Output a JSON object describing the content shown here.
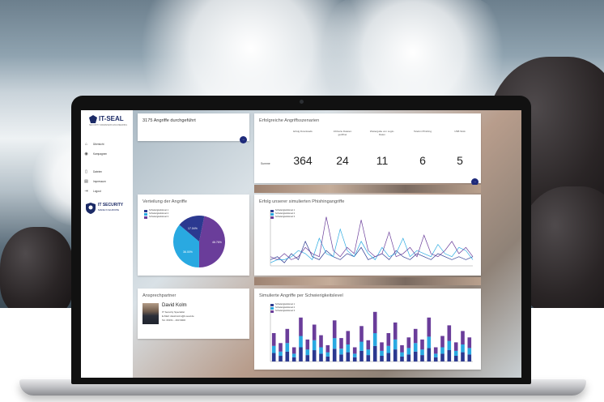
{
  "sidebar": {
    "logo": "IT-SEAL",
    "logo_sub": "SECURITY AWARENESS ENGINEERING",
    "items": [
      {
        "label": "Übersicht",
        "icon": "home-icon"
      },
      {
        "label": "Kampagnen",
        "icon": "target-icon"
      },
      {
        "label": "Dateien",
        "icon": "file-icon"
      },
      {
        "label": "Impressum",
        "icon": "document-icon"
      },
      {
        "label": "Logout",
        "icon": "logout-icon"
      }
    ],
    "badge_title": "IT SECURITY",
    "badge_sub": "MADE IN EUROPE"
  },
  "kpi": {
    "title": "3175 Angriffe durchgeführt"
  },
  "success": {
    "title": "Erfolgreiche Angriffsszenarien",
    "row_label": "Summe",
    "columns": [
      {
        "label": "Erfolg Downloads",
        "value": "364"
      },
      {
        "label": "Infizierte Dateien geöffnet",
        "value": "24"
      },
      {
        "label": "Weitergabe von Login-Daten",
        "value": "11"
      },
      {
        "label": "Telefon Phishing",
        "value": "6"
      },
      {
        "label": "USB Stick",
        "value": "5"
      }
    ]
  },
  "pie": {
    "title": "Verteilung der Angriffe",
    "legend": [
      "Schwierigkeitslevel 1",
      "Schwierigkeitslevel 2",
      "Schwierigkeitslevel 3"
    ],
    "labels": [
      "46.76%",
      "36.00%",
      "17.04%"
    ]
  },
  "line": {
    "title": "Erfolg unserer simulierten Phishingangriffe"
  },
  "contact": {
    "title": "Ansprechpartner",
    "name": "David Kolm",
    "lines": [
      "IT Security Specialist",
      "E-Mail: david.kolm@it-seal.de",
      "Tel. 06151 - 493 9900"
    ]
  },
  "bars": {
    "title": "Simulierte Angriffe per Schwierigkeitslevel"
  },
  "colors": {
    "level1": "#2b3990",
    "level2": "#29a9e1",
    "level3": "#6a3d9a",
    "fab": "#1e2a7a"
  },
  "chart_data": [
    {
      "type": "pie",
      "title": "Verteilung der Angriffe",
      "labels": [
        "Schwierigkeitslevel 3",
        "Schwierigkeitslevel 2",
        "Schwierigkeitslevel 1"
      ],
      "values": [
        46.76,
        36.0,
        17.04
      ]
    },
    {
      "type": "line",
      "title": "Erfolg unserer simulierten Phishingangriffe",
      "x": [
        1,
        2,
        3,
        4,
        5,
        6,
        7,
        8,
        9,
        10,
        11,
        12,
        13,
        14,
        15,
        16,
        17,
        18,
        19,
        20,
        21,
        22,
        23,
        24,
        25,
        26,
        27,
        28,
        29,
        30
      ],
      "series": [
        {
          "name": "Schwierigkeitslevel 1",
          "values": [
            2,
            3,
            1,
            4,
            2,
            8,
            3,
            2,
            5,
            3,
            2,
            4,
            3,
            6,
            2,
            3,
            4,
            2,
            5,
            3,
            2,
            4,
            3,
            2,
            4,
            3,
            2,
            3,
            2,
            3
          ]
        },
        {
          "name": "Schwierigkeitslevel 2",
          "values": [
            1,
            2,
            2,
            3,
            5,
            4,
            2,
            9,
            4,
            3,
            12,
            5,
            3,
            8,
            4,
            2,
            6,
            3,
            4,
            9,
            3,
            5,
            4,
            3,
            7,
            4,
            3,
            6,
            5,
            2
          ]
        },
        {
          "name": "Schwierigkeitslevel 3",
          "values": [
            3,
            2,
            4,
            2,
            3,
            6,
            4,
            3,
            16,
            5,
            3,
            6,
            4,
            15,
            5,
            3,
            4,
            11,
            3,
            4,
            6,
            3,
            10,
            4,
            3,
            5,
            8,
            4,
            6,
            3
          ]
        }
      ],
      "ylim": [
        0,
        18
      ]
    },
    {
      "type": "bar",
      "title": "Simulierte Angriffe per Schwierigkeitslevel",
      "stacked": true,
      "series": [
        {
          "name": "Schwierigkeitslevel 1",
          "values": [
            12,
            8,
            14,
            6,
            20,
            9,
            16,
            11,
            7,
            18,
            10,
            13,
            6,
            15,
            9,
            22,
            8,
            12,
            17,
            7,
            10,
            14,
            9,
            19,
            6,
            11,
            16,
            8,
            13,
            10
          ]
        },
        {
          "name": "Schwierigkeitslevel 2",
          "values": [
            10,
            6,
            12,
            5,
            16,
            8,
            14,
            9,
            6,
            15,
            8,
            11,
            5,
            13,
            8,
            18,
            7,
            10,
            14,
            6,
            9,
            12,
            8,
            16,
            5,
            9,
            13,
            7,
            11,
            9
          ]
        },
        {
          "name": "Schwierigkeitslevel 3",
          "values": [
            18,
            12,
            20,
            9,
            26,
            14,
            22,
            17,
            10,
            25,
            15,
            19,
            9,
            22,
            13,
            30,
            12,
            18,
            24,
            10,
            15,
            20,
            14,
            27,
            9,
            16,
            22,
            12,
            19,
            15
          ]
        }
      ],
      "ylim": [
        0,
        80
      ]
    }
  ]
}
